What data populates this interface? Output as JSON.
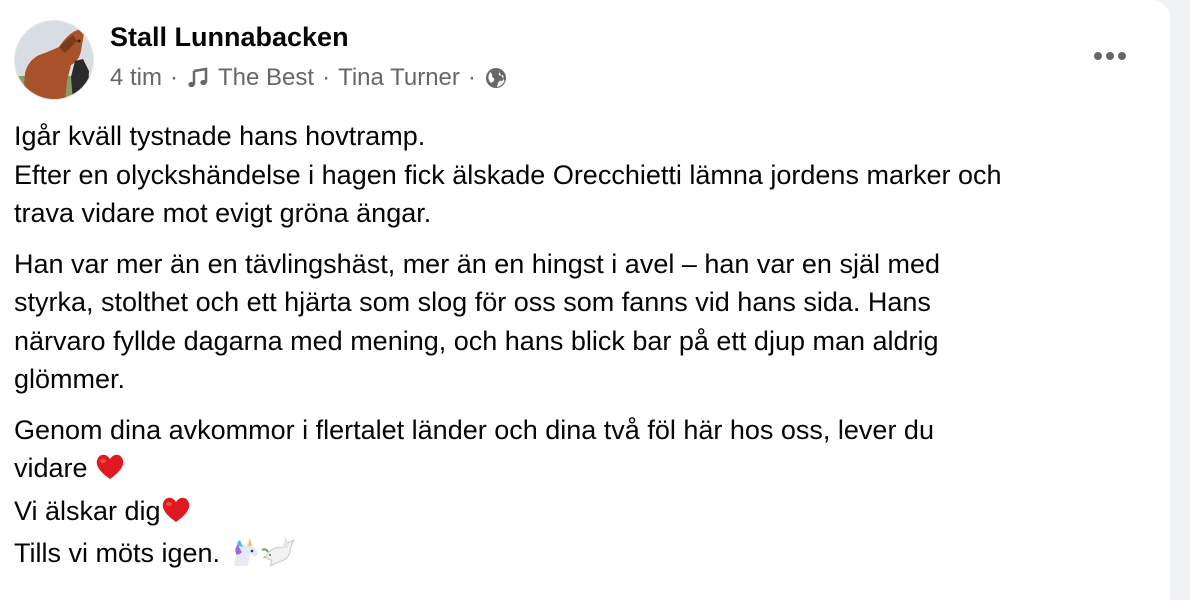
{
  "post": {
    "author": "Stall Lunnabacken",
    "meta": {
      "time": "4 tim",
      "separator": "·",
      "song_title": "The Best",
      "artist": "Tina Turner",
      "audience_icon": "globe-icon",
      "music_icon": "music-note-icon"
    },
    "menu_icon": "more-options-icon",
    "paragraphs": [
      [
        "Igår kväll tystnade hans hovtramp.",
        "Efter en olyckshändelse i hagen fick älskade Orecchietti lämna jordens marker och",
        "trava vidare mot evigt gröna ängar."
      ],
      [
        "Han var mer än en tävlingshäst, mer än en hingst i avel – han var en själ med",
        "styrka, stolthet och ett hjärta som slog för oss som fanns vid hans sida. Hans",
        "närvaro fyllde dagarna med mening, och hans blick bar på ett djup man aldrig",
        "glömmer."
      ],
      [
        "Genom dina avkommor i flertalet länder och dina två föl här hos oss, lever du",
        "vidare ",
        "Vi älskar dig",
        "Tills vi möts igen. "
      ]
    ],
    "emojis": [
      "red-heart",
      "red-heart",
      "unicorn",
      "dove"
    ]
  }
}
